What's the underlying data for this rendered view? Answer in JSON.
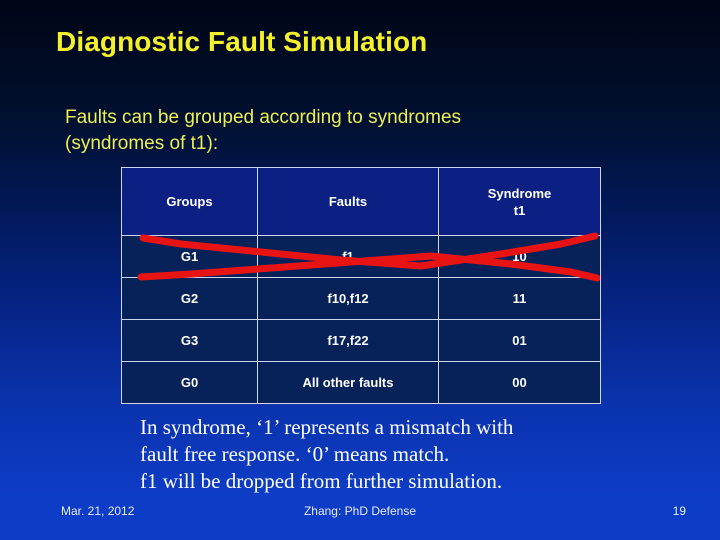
{
  "slide": {
    "title": "Diagnostic Fault Simulation",
    "bullet": "Faults can be grouped according to syndromes (syndromes of t1):",
    "note_line1": "In syndrome, ‘1’ represents a mismatch with",
    "note_line2": "fault free response. ‘0’ means match.",
    "note_line3": "f1 will be dropped from further simulation."
  },
  "table": {
    "headers": {
      "groups": "Groups",
      "faults": "Faults",
      "syndrome_line1": "Syndrome",
      "syndrome_line2": "t1"
    },
    "rows": [
      {
        "group": "G1",
        "faults": "f1",
        "syndrome": "10",
        "struck_out": true
      },
      {
        "group": "G2",
        "faults": "f10,f12",
        "syndrome": "11",
        "struck_out": false
      },
      {
        "group": "G3",
        "faults": "f17,f22",
        "syndrome": "01",
        "struck_out": false
      },
      {
        "group": "G0",
        "faults": "All other faults",
        "syndrome": "00",
        "struck_out": false
      }
    ]
  },
  "annotation": {
    "type": "red-cross-out",
    "color": "#e81414",
    "target_row": "G1"
  },
  "footer": {
    "date": "Mar.  21, 2012",
    "center": "Zhang: PhD Defense",
    "page": "19"
  },
  "colors": {
    "title": "#f5f02a",
    "bullet": "#eeee52",
    "table_header_bg": "#0c2083",
    "table_cell_bg": "#072159",
    "table_border": "#cdd6ec",
    "annotation_red": "#e81414",
    "background_top": "#000516",
    "background_bottom": "#0d3cc6"
  }
}
